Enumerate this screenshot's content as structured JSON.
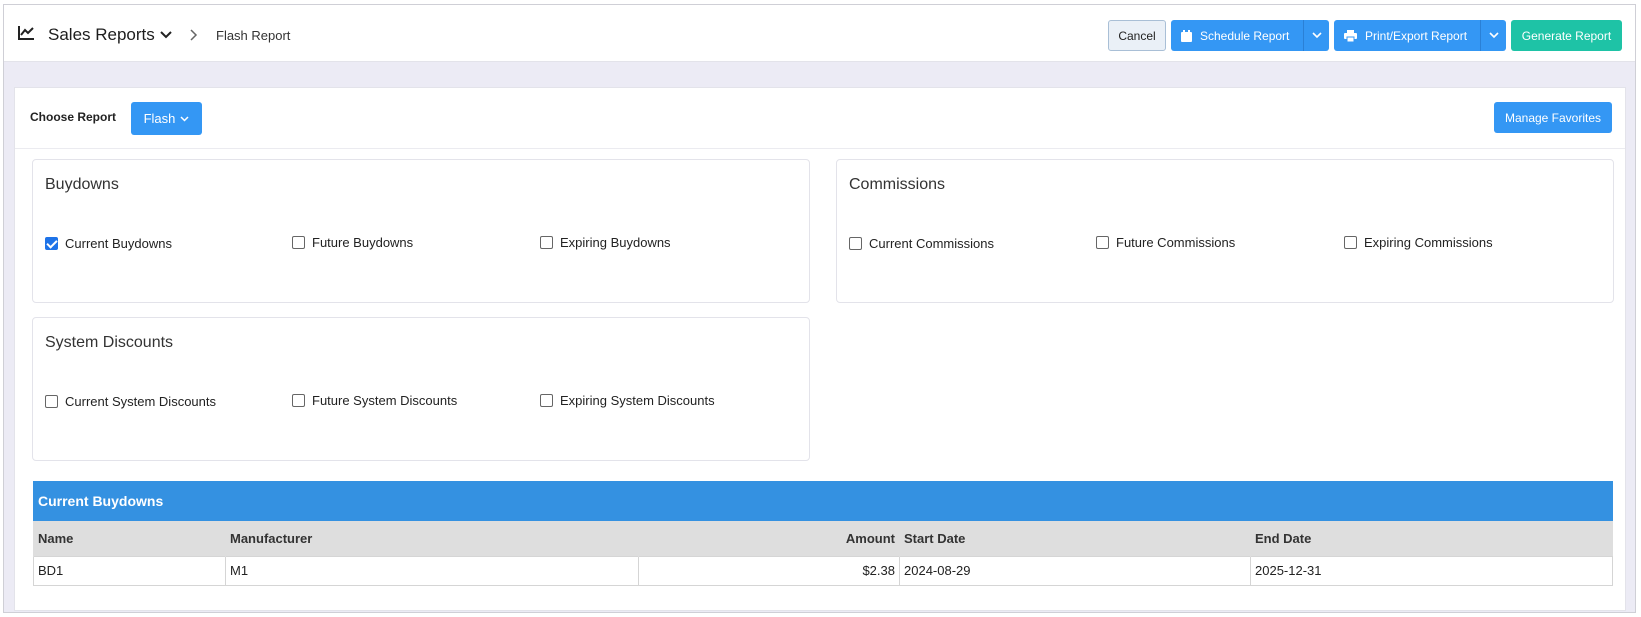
{
  "header": {
    "section_title": "Sales Reports",
    "current_page": "Flash Report",
    "buttons": {
      "cancel": "Cancel",
      "schedule": "Schedule Report",
      "print_export": "Print/Export Report",
      "generate": "Generate Report"
    }
  },
  "report_selector": {
    "label": "Choose Report",
    "selected": "Flash",
    "manage_favorites": "Manage Favorites"
  },
  "groups": {
    "buydowns": {
      "title": "Buydowns",
      "options": [
        {
          "label": "Current Buydowns",
          "checked": true
        },
        {
          "label": "Future Buydowns",
          "checked": false
        },
        {
          "label": "Expiring Buydowns",
          "checked": false
        }
      ]
    },
    "commissions": {
      "title": "Commissions",
      "options": [
        {
          "label": "Current Commissions",
          "checked": false
        },
        {
          "label": "Future Commissions",
          "checked": false
        },
        {
          "label": "Expiring Commissions",
          "checked": false
        }
      ]
    },
    "system_discounts": {
      "title": "System Discounts",
      "options": [
        {
          "label": "Current System Discounts",
          "checked": false
        },
        {
          "label": "Future System Discounts",
          "checked": false
        },
        {
          "label": "Expiring System Discounts",
          "checked": false
        }
      ]
    }
  },
  "results": {
    "title": "Current Buydowns",
    "columns": [
      "Name",
      "Manufacturer",
      "Amount",
      "Start Date",
      "End Date"
    ],
    "rows": [
      [
        "BD1",
        "M1",
        "$2.38",
        "2024-08-29",
        "2025-12-31"
      ]
    ]
  },
  "colors": {
    "primary": "#3497f4",
    "success": "#1ec3a6",
    "table_header": "#3491e1",
    "background": "#ecebf5"
  },
  "icons": [
    "chart-line-icon",
    "chevron-down-icon",
    "chevron-right-icon",
    "calendar-icon",
    "printer-icon"
  ]
}
